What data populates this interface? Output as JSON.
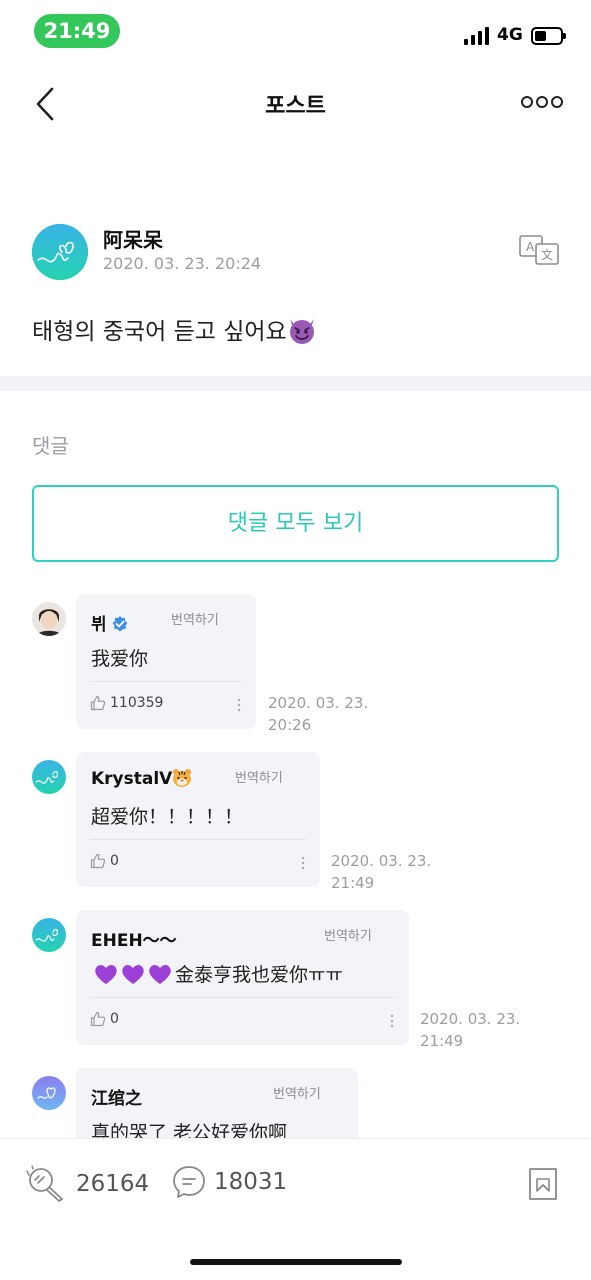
{
  "status": {
    "time": "21:49",
    "network": "4G",
    "battery_level": 0.45
  },
  "nav": {
    "title": "포스트"
  },
  "post": {
    "author": "阿呆呆",
    "date": "2020. 03. 23. 20:24",
    "body": "태형의 중국어 듣고 싶어요"
  },
  "comments_section": {
    "label": "댓글",
    "view_all": "댓글 모두 보기",
    "items": [
      {
        "name": "뷔",
        "translate": "번역하기",
        "text": "我爱你",
        "likes": "110359",
        "date_line1": "2020. 03. 23.",
        "date_line2": "20:26"
      },
      {
        "name": "KrystalV",
        "translate": "번역하기",
        "text": "超爱你！！！！！",
        "likes": "0",
        "date_line1": "2020. 03. 23.",
        "date_line2": "21:49"
      },
      {
        "name": "EHEH～～",
        "translate": "번역하기",
        "text": "金泰亨我也爱你ㅠㅠ",
        "likes": "0",
        "date_line1": "2020. 03. 23.",
        "date_line2": "21:49"
      },
      {
        "name": "江绾之",
        "translate": "번역하기",
        "text": "真的哭了 老公好爱你啊"
      }
    ]
  },
  "bottom_bar": {
    "likes": "26164",
    "comments": "18031"
  },
  "colors": {
    "accent": "#31d1bd",
    "time_pill": "#34c759",
    "bubble": "#f3f4f8"
  }
}
